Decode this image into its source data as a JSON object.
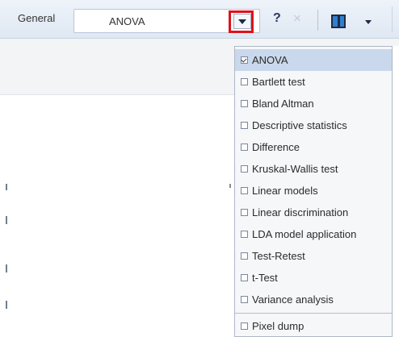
{
  "toolbar": {
    "section_label": "General",
    "combo_value": "ANOVA",
    "help_label": "?",
    "close_label": "×"
  },
  "dropdown": {
    "items": [
      {
        "label": "ANOVA",
        "checked": true
      },
      {
        "label": "Bartlett test",
        "checked": false
      },
      {
        "label": "Bland Altman",
        "checked": false
      },
      {
        "label": "Descriptive statistics",
        "checked": false
      },
      {
        "label": "Difference",
        "checked": false
      },
      {
        "label": "Kruskal-Wallis test",
        "checked": false
      },
      {
        "label": "Linear models",
        "checked": false
      },
      {
        "label": "Linear discrimination",
        "checked": false
      },
      {
        "label": "LDA model application",
        "checked": false
      },
      {
        "label": "Test-Retest",
        "checked": false
      },
      {
        "label": "t-Test",
        "checked": false
      },
      {
        "label": "Variance analysis",
        "checked": false
      },
      {
        "label": "Pixel dump",
        "checked": false
      }
    ]
  },
  "colors": {
    "highlight": "#e0111a",
    "selected_row": "#c9d8ec",
    "toolbar_bg": "#e6edf6"
  }
}
